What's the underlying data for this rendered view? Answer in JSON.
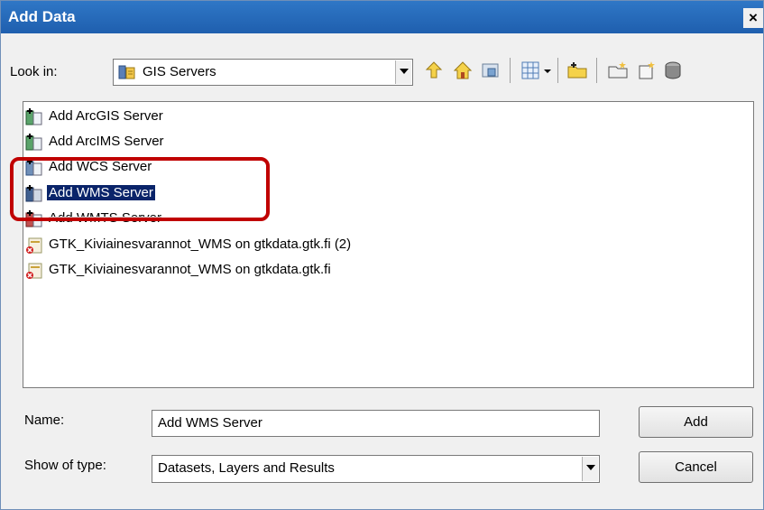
{
  "window": {
    "title": "Add Data",
    "close_glyph": "×"
  },
  "look_in": {
    "label": "Look in:",
    "value": "GIS Servers"
  },
  "toolbar": [
    {
      "name": "up-one-level-icon"
    },
    {
      "name": "home-icon"
    },
    {
      "name": "go-to-default-folder-icon"
    },
    {
      "name": "view-menu-icon"
    },
    {
      "name": "connect-to-folder-icon"
    },
    {
      "name": "new-folder-icon"
    },
    {
      "name": "new-file-geodatabase-icon"
    },
    {
      "name": "new-personal-geodatabase-icon"
    }
  ],
  "list": {
    "items": [
      {
        "label": "Add ArcGIS Server",
        "icon": "add-server-icon",
        "state": "normal"
      },
      {
        "label": "Add ArcIMS Server",
        "icon": "add-server-icon",
        "state": "normal"
      },
      {
        "label": "Add WCS Server",
        "icon": "add-server-icon",
        "state": "normal"
      },
      {
        "label": "Add WMS Server",
        "icon": "add-server-icon",
        "state": "selected"
      },
      {
        "label": "Add WMTS Server",
        "icon": "add-server-icon",
        "state": "obscured"
      },
      {
        "label": "GTK_Kiviainesvarannot_WMS on gtkdata.gtk.fi (2)",
        "icon": "broken-connection-icon",
        "state": "normal"
      },
      {
        "label": "GTK_Kiviainesvarannot_WMS on gtkdata.gtk.fi",
        "icon": "broken-connection-icon",
        "state": "normal"
      }
    ]
  },
  "name_field": {
    "label": "Name:",
    "value": "Add WMS Server"
  },
  "type_field": {
    "label": "Show of type:",
    "value": "Datasets, Layers and Results"
  },
  "buttons": {
    "add": "Add",
    "cancel": "Cancel"
  },
  "colors": {
    "titlebar": "#2f77c6",
    "selection": "#0a246a",
    "annotation": "#c00000"
  }
}
